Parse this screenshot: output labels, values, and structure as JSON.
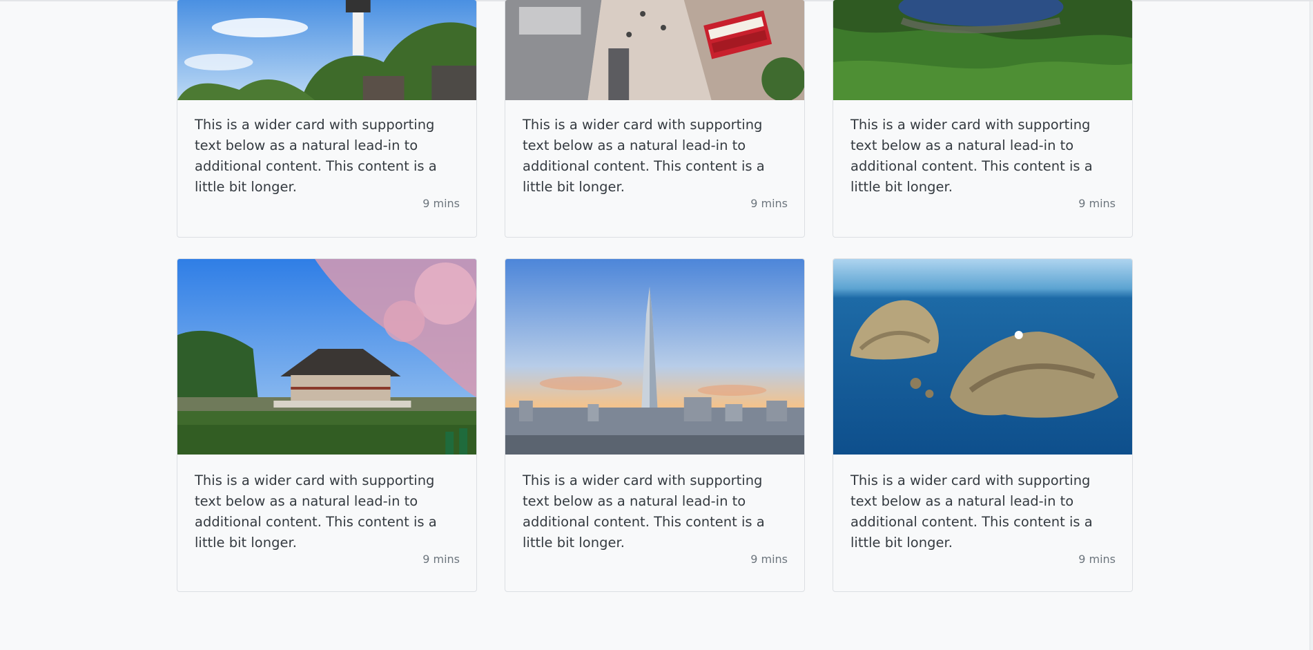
{
  "cards": [
    {
      "text": "This is a wider card with supporting text below as a natural lead-in to additional content. This content is a little bit longer.",
      "time": "9 mins",
      "image": "tower-park-photo"
    },
    {
      "text": "This is a wider card with supporting text below as a natural lead-in to additional content. This content is a little bit longer.",
      "time": "9 mins",
      "image": "street-tram-photo"
    },
    {
      "text": "This is a wider card with supporting text below as a natural lead-in to additional content. This content is a little bit longer.",
      "time": "9 mins",
      "image": "green-coast-photo"
    },
    {
      "text": "This is a wider card with supporting text below as a natural lead-in to additional content. This content is a little bit longer.",
      "time": "9 mins",
      "image": "palace-pavilion-photo"
    },
    {
      "text": "This is a wider card with supporting text below as a natural lead-in to additional content. This content is a little bit longer.",
      "time": "9 mins",
      "image": "skyscraper-skyline-photo"
    },
    {
      "text": "This is a wider card with supporting text below as a natural lead-in to additional content. This content is a little bit longer.",
      "time": "9 mins",
      "image": "rocky-islands-photo"
    }
  ],
  "colors": {
    "page_background": "#f8f9fa",
    "card_border": "#dcdfe3",
    "body_text": "#343a40",
    "muted_text": "#6c757d"
  }
}
